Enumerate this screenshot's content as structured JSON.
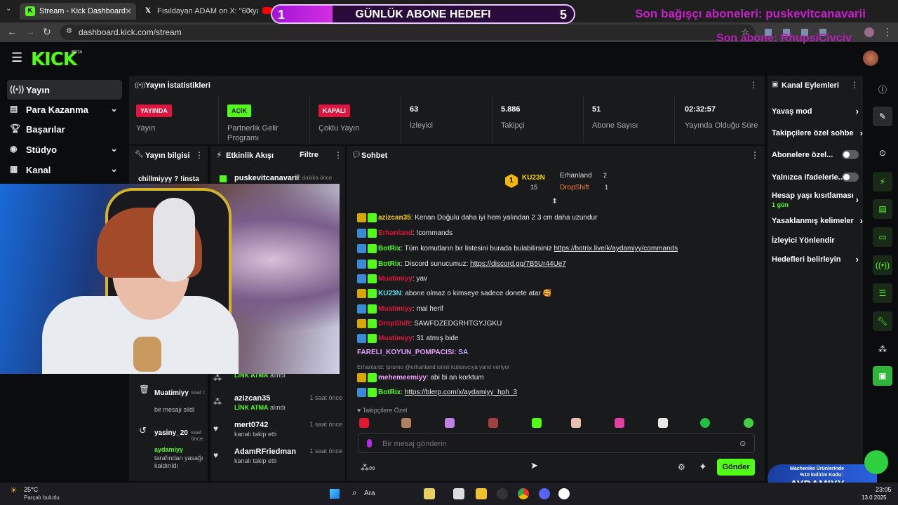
{
  "browser": {
    "tabs": [
      {
        "title": "Stream - Kick Dashboard",
        "icon": "kick-icon",
        "active": true
      },
      {
        "title": "Fısıldayan ADAM on X: \"60 yaşınd",
        "icon": "x-icon",
        "active": false
      }
    ],
    "url": "dashboard.kick.com/stream"
  },
  "overlays": {
    "goal": {
      "title": "GÜNLÜK ABONE HEDEFI",
      "current": "1",
      "target": "5",
      "progress": 0.2
    },
    "last_donor": "Son bağışçı aboneleri: puskevitcanavarii",
    "last_sub": "Son abone: RhupsiCivciv"
  },
  "brand": {
    "logo": "KICK",
    "beta": "BETA",
    "accent": "#53fc18"
  },
  "left_nav": {
    "items": [
      {
        "label": "Yayın",
        "icon": "broadcast-icon",
        "active": true
      },
      {
        "label": "Para Kazanma",
        "icon": "money-icon",
        "chevron": true
      },
      {
        "label": "Başarılar",
        "icon": "trophy-icon"
      },
      {
        "label": "Stüdyo",
        "icon": "studio-icon",
        "chevron": true
      },
      {
        "label": "Kanal",
        "icon": "channel-icon",
        "chevron": true
      }
    ]
  },
  "stats": {
    "title": "Yayın İstatistikleri",
    "cells": [
      {
        "badge": "YAYINDA",
        "badge_color": "#e0143c",
        "label": "Yayın"
      },
      {
        "badge": "AÇIK",
        "badge_color": "#53fc18",
        "label": "Partnerlik Gelir Programı"
      },
      {
        "badge": "KAPALI",
        "badge_color": "#e0143c",
        "label": "Çoklu Yayın"
      },
      {
        "value": "63",
        "label": "İzleyici"
      },
      {
        "value": "5.886",
        "label": "Takipçi"
      },
      {
        "value": "51",
        "label": "Abone Sayısı"
      },
      {
        "value": "02:32:57",
        "label": "Yayında Olduğu Süre"
      }
    ]
  },
  "stream_info": {
    "title": "Yayın bilgisi",
    "title_preview": "chillmiyyy ? !insta",
    "entries": [
      {
        "name": "Muatimiyy",
        "time": "saat önce",
        "text": "bir mesajı sildi"
      },
      {
        "name": "yasiny_20",
        "time": "saat önce",
        "target": "aydamiyy",
        "text": "tarafından yasağı kaldırıldı"
      }
    ]
  },
  "activity": {
    "title": "Etkinlik Akışı",
    "filter": "Filtre",
    "top": {
      "name": "puskevitcanavarii",
      "time": "2 dakika önce"
    },
    "rows": [
      {
        "name": "",
        "sub": "LİNK ATMA",
        "sub2": "alındı",
        "time": ""
      },
      {
        "name": "azizcan35",
        "sub": "LİNK ATMA",
        "sub2": "alındı",
        "time": "1 saat önce"
      },
      {
        "name": "mert0742",
        "sub": "kanalı takip etti",
        "sub2": "",
        "time": "1 saat önce"
      },
      {
        "name": "AdamRFriedman",
        "sub": "kanalı takip etti",
        "sub2": "",
        "time": "1 saat önce"
      }
    ]
  },
  "chat": {
    "title": "Sohbet",
    "leaders": [
      {
        "name": "KU23N",
        "count": "15",
        "rank": "1"
      },
      {
        "name": "Erhanland",
        "count": "2"
      },
      {
        "name": "DropShift",
        "count": "1"
      }
    ],
    "messages": [
      {
        "user": "azizcan35",
        "color": "#f5d000",
        "text": ": Kenan Doğulu daha iyi hem yalından 2 3 cm daha uzundur"
      },
      {
        "user": "Erhanland",
        "color": "#e0143c",
        "text": ": !commands"
      },
      {
        "user": "BotRix",
        "color": "#53fc18",
        "text": ": Tüm komutların bir listesini burada bulabilirsiniz ",
        "link": "https://botrix.live/k/aydamiyy/commands"
      },
      {
        "user": "BotRix",
        "color": "#53fc18",
        "text": ": Discord sunucumuz: ",
        "link": "https://discord.gg/7B5Ur44Ue7"
      },
      {
        "user": "Muatimiyy",
        "color": "#e0143c",
        "text": ": yav"
      },
      {
        "user": "KU23N",
        "color": "#53e0f0",
        "text": ": abone olmaz o kimseye sadece donete atar 🥰"
      },
      {
        "user": "Muatimiyy",
        "color": "#e0143c",
        "text": ": mal herif"
      },
      {
        "user": "DropShift",
        "color": "#e0143c",
        "text": ": SAWFDZEDGRHTGYJGKU"
      },
      {
        "user": "Muatimiyy",
        "color": "#e0143c",
        "text": ": 31 atmış bide"
      },
      {
        "user": "FARELI_KOYUN_POMPACISI",
        "color": "#e8a0ff",
        "text": ": SA"
      },
      {
        "user": "mehemeemiyy",
        "color": "#f0a0ff",
        "text": ": abi bi an korktum",
        "reply": "Erhanland: !promo @erhanland isimli kullanıcıya yanıt veriyor"
      },
      {
        "user": "BotRix",
        "color": "#53fc18",
        "text": ": ",
        "link": "https://blerp.com/x/aydamiyy_hph_3"
      }
    ],
    "followers_only": "Takipçilere Özel",
    "input_placeholder": "Bir mesaj gönderin",
    "send_label": "Gönder"
  },
  "channel_actions": {
    "title": "Kanal Eylemleri",
    "items": [
      {
        "label": "Yavaş mod",
        "type": "chevron"
      },
      {
        "label": "Takipçilere özel sohbe",
        "type": "chevron"
      },
      {
        "label": "Abonelere özel...",
        "type": "toggle"
      },
      {
        "label": "Yalnızca ifadelerle...",
        "type": "toggle"
      },
      {
        "label": "Hesap yaşı kısıtlaması",
        "sub": "1 gün",
        "type": "chevron"
      },
      {
        "label": "Yasaklanmış kelimeler",
        "type": "chevron"
      },
      {
        "label": "İzleyici Yönlendir",
        "type": "none"
      },
      {
        "label": "Hedefleri belirleyin",
        "type": "chevron"
      }
    ]
  },
  "taskbar": {
    "temp": "25°C",
    "weather": "Parçalı bulutlu",
    "search": "Ara",
    "time": "23:05",
    "date": "13.0 2025"
  },
  "promo": {
    "line1": "Machenike Ürünlerinde",
    "line2": "%10 İndirim Kodu:",
    "code": "AYDAMIYY"
  }
}
